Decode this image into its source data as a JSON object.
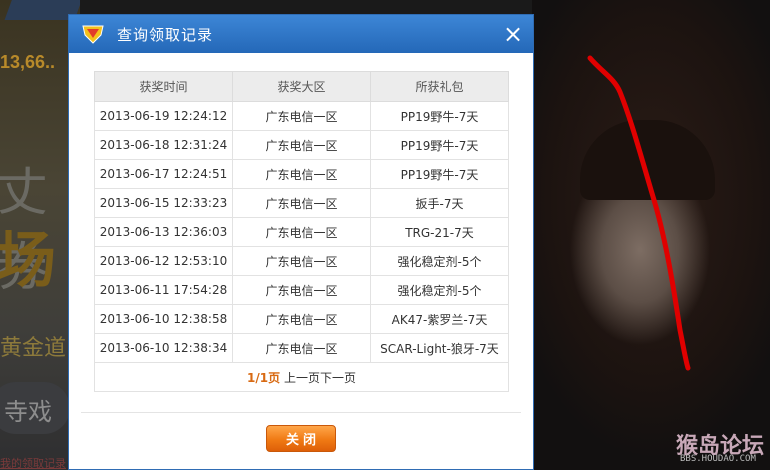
{
  "background": {
    "price_fragment": "13,66..",
    "big_char_1": "丈券",
    "big_char_2": "场",
    "gold_text": "黄金道",
    "game_button": "寺戏",
    "footer_link": "我的领取记录",
    "watermark": "猴岛论坛",
    "watermark_url": "BBS.HOUDAO.COM"
  },
  "dialog": {
    "title": "查询领取记录",
    "close_icon": "×",
    "columns": [
      "获奖时间",
      "获奖大区",
      "所获礼包"
    ],
    "rows": [
      {
        "time": "2013-06-19 12:24:12",
        "region": "广东电信一区",
        "gift": "PP19野牛-7天"
      },
      {
        "time": "2013-06-18 12:31:24",
        "region": "广东电信一区",
        "gift": "PP19野牛-7天"
      },
      {
        "time": "2013-06-17 12:24:51",
        "region": "广东电信一区",
        "gift": "PP19野牛-7天"
      },
      {
        "time": "2013-06-15 12:33:23",
        "region": "广东电信一区",
        "gift": "扳手-7天"
      },
      {
        "time": "2013-06-13 12:36:03",
        "region": "广东电信一区",
        "gift": "TRG-21-7天"
      },
      {
        "time": "2013-06-12 12:53:10",
        "region": "广东电信一区",
        "gift": "强化稳定剂-5个"
      },
      {
        "time": "2013-06-11 17:54:28",
        "region": "广东电信一区",
        "gift": "强化稳定剂-5个"
      },
      {
        "time": "2013-06-10 12:38:58",
        "region": "广东电信一区",
        "gift": "AK47-紫罗兰-7天"
      },
      {
        "time": "2013-06-10 12:38:34",
        "region": "广东电信一区",
        "gift": "SCAR-Light-狼牙-7天"
      }
    ],
    "pager": {
      "current": "1/1页",
      "prev": "上一页",
      "next": "下一页"
    },
    "close_button": "关闭"
  },
  "colors": {
    "titlebar": "#2a6fc0",
    "accent_orange": "#f07a14",
    "pager_current": "#d86a13",
    "annotation_red": "#e00000"
  }
}
